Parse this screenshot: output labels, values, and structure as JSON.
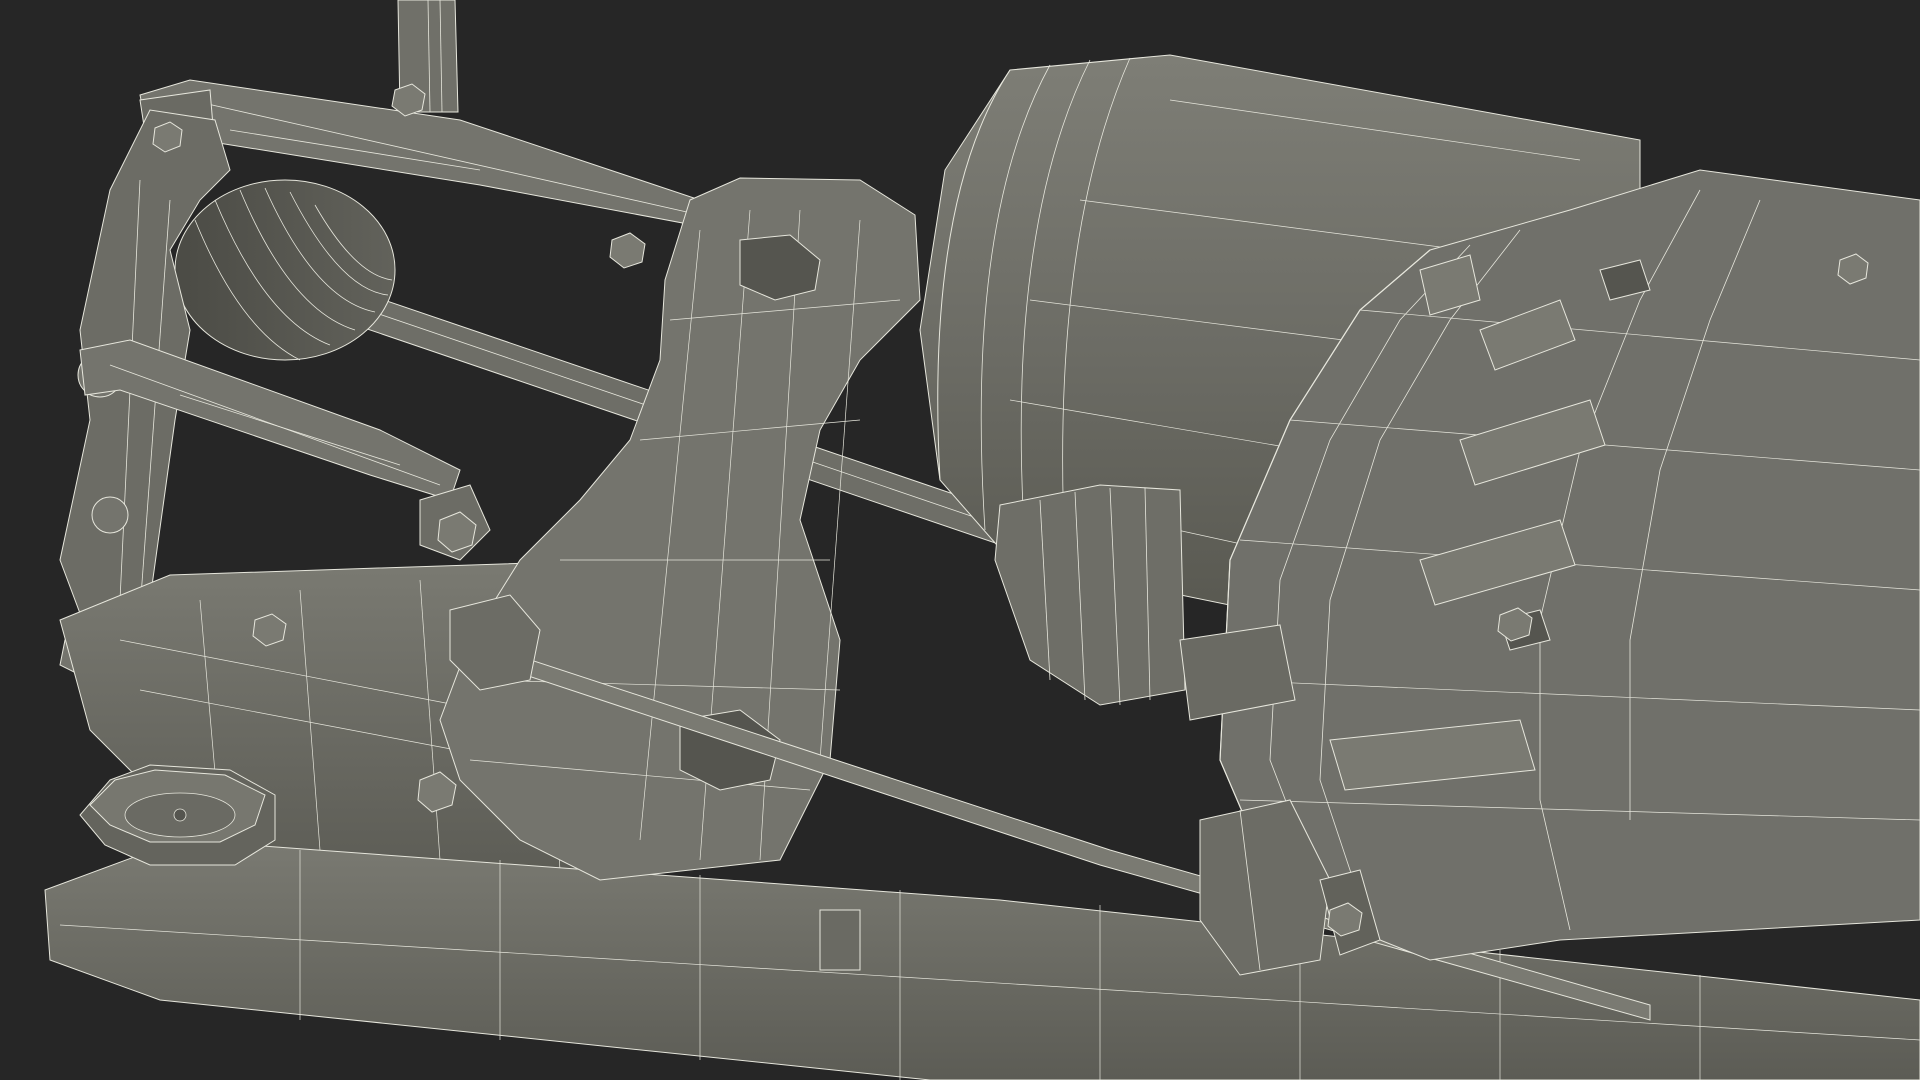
{
  "scene": {
    "background_color": "#262626",
    "surface_color": "#6f6f68",
    "surface_light": "#7c7c74",
    "surface_dark": "#55554f",
    "wire_color": "#e6e6dc"
  }
}
